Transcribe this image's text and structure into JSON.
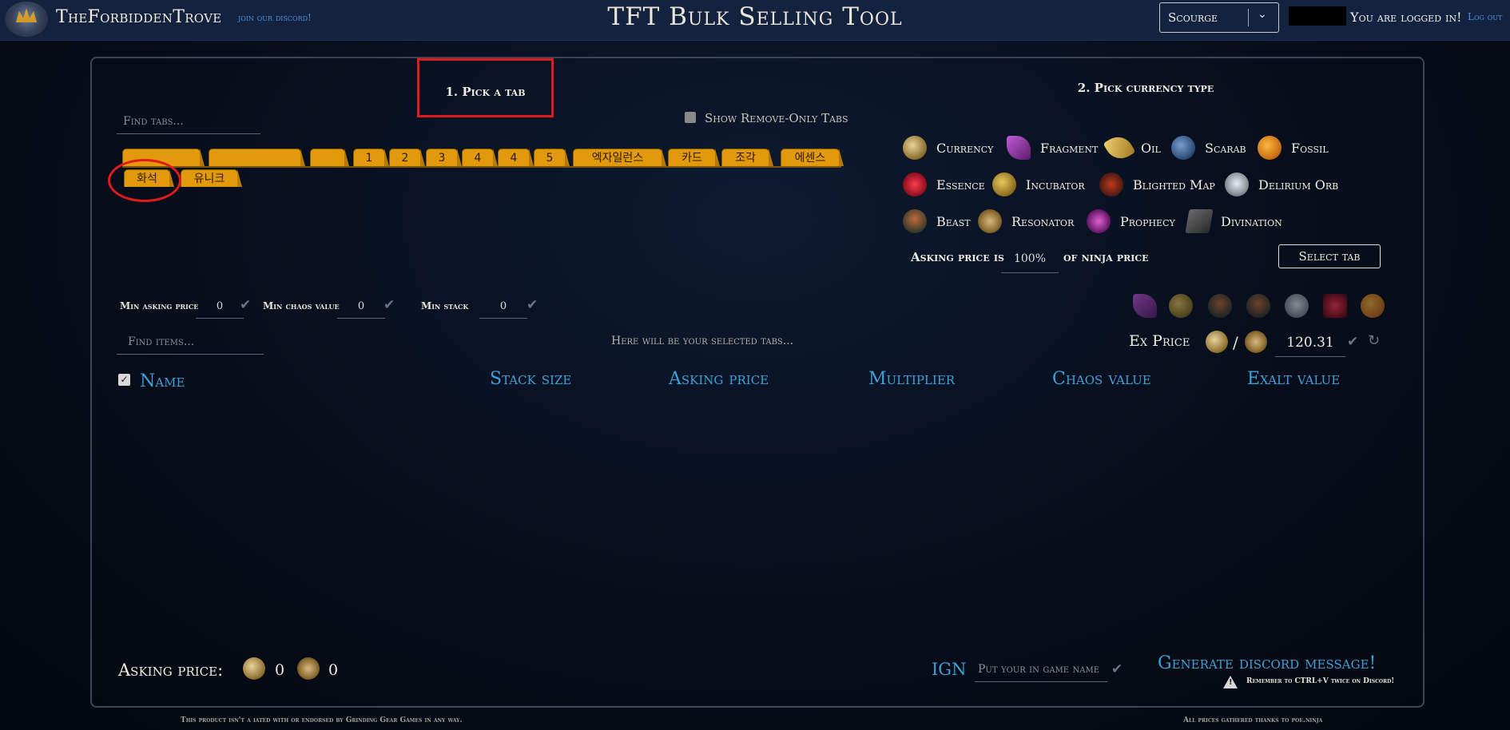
{
  "header": {
    "brand": "TheForbiddenTrove",
    "discord_link": "join our discord!",
    "title": "TFT Bulk Selling Tool",
    "league_selected": "Scourge",
    "logged_in_text": "You are logged in!",
    "logout": "Log out"
  },
  "step1": {
    "label": "1. Pick a tab"
  },
  "step2": {
    "label": "2. Pick currency type"
  },
  "tabs_panel": {
    "find_placeholder": "Find tabs...",
    "show_remove_only": "Show Remove-Only Tabs",
    "tabs_row1": [
      "",
      "",
      "",
      "1",
      "2",
      "3",
      "4",
      "4",
      "5",
      "엑자일런스",
      "카드",
      "조각",
      "에센스"
    ],
    "tabs_row2": [
      "화석",
      "유니크"
    ]
  },
  "currency_types": [
    {
      "label": "Currency",
      "icon": "currency-icon"
    },
    {
      "label": "Fragment",
      "icon": "fragment-icon"
    },
    {
      "label": "Oil",
      "icon": "oil-icon"
    },
    {
      "label": "Scarab",
      "icon": "scarab-icon"
    },
    {
      "label": "Fossil",
      "icon": "fossil-icon"
    },
    {
      "label": "Essence",
      "icon": "essence-icon"
    },
    {
      "label": "Incubator",
      "icon": "incubator-icon"
    },
    {
      "label": "Blighted Map",
      "icon": "blighted-map-icon"
    },
    {
      "label": "Delirium Orb",
      "icon": "delirium-orb-icon"
    },
    {
      "label": "Beast",
      "icon": "beast-icon"
    },
    {
      "label": "Resonator",
      "icon": "resonator-icon"
    },
    {
      "label": "Prophecy",
      "icon": "prophecy-icon"
    },
    {
      "label": "Divination",
      "icon": "divination-icon"
    }
  ],
  "asking": {
    "prefix": "Asking price is",
    "percent": "100%",
    "suffix": "of ninja price",
    "select_tab": "Select tab"
  },
  "filters": {
    "min_asking_label": "Min asking price",
    "min_asking_value": "0",
    "min_chaos_label": "Min chaos value",
    "min_chaos_value": "0",
    "min_stack_label": "Min stack",
    "min_stack_value": "0"
  },
  "items": {
    "find_placeholder": "Find items...",
    "selected_msg": "Here will be your selected tabs..."
  },
  "ex_price": {
    "label": "Ex Price",
    "slash": "/",
    "value": "120.31"
  },
  "table": {
    "columns": [
      "Name",
      "Stack size",
      "Asking price",
      "Multiplier",
      "Chaos value",
      "Exalt value"
    ]
  },
  "bottom": {
    "asking_label": "Asking price:",
    "chaos_total": "0",
    "exalt_total": "0",
    "ign_label": "IGN",
    "ign_placeholder": "Put your in game name",
    "generate": "Generate discord message!",
    "remember": "Remember to CTRL+V twice on Discord!"
  },
  "footer": {
    "left": "This product isn't a   iated with or endorsed by Grinding Gear Games in any way.",
    "right": "All prices gathered thanks to poe.ninja"
  },
  "colors": {
    "topbar": "#13233f",
    "tab": "#e29a0c",
    "accent_blue": "#3fa0d8",
    "highlight_red": "#e01b1b"
  }
}
